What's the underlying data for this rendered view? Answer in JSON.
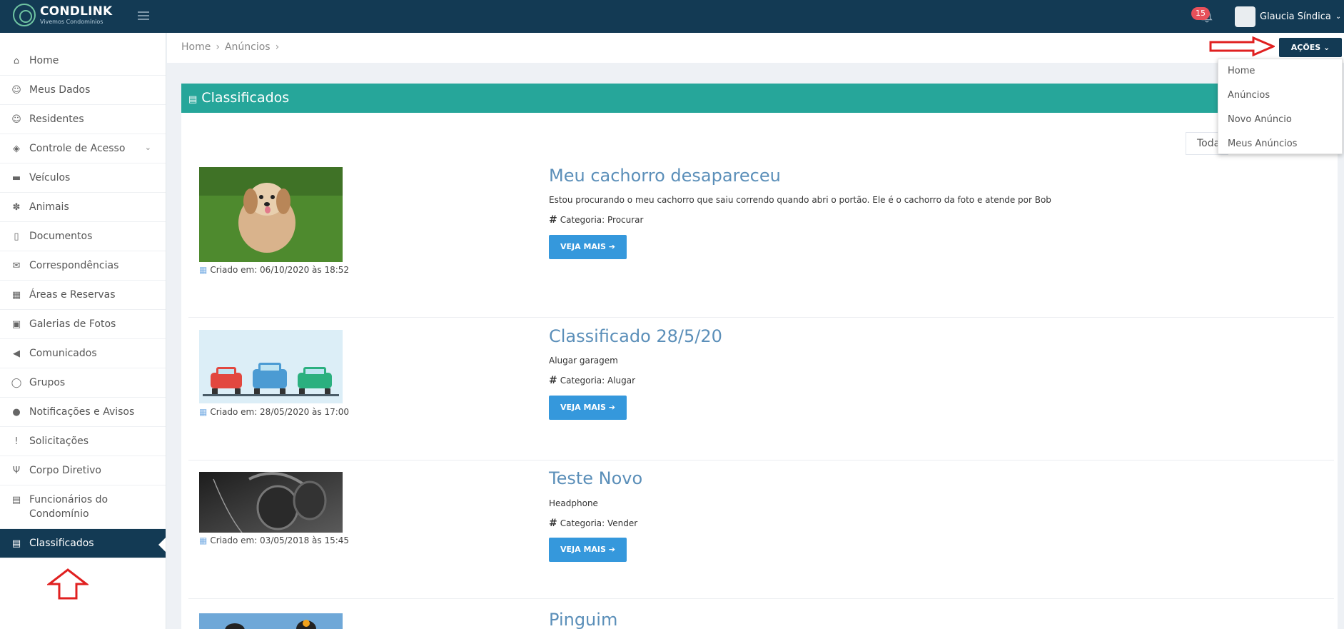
{
  "brand": {
    "name": "CONDLINK",
    "tagline": "Vivemos Condomínios"
  },
  "header": {
    "notifications_count": "15",
    "user_name": "Glaucia Síndica"
  },
  "sidebar": {
    "items": [
      {
        "label": "Home",
        "icon": "home-icon"
      },
      {
        "label": "Meus Dados",
        "icon": "user-icon"
      },
      {
        "label": "Residentes",
        "icon": "user-icon"
      },
      {
        "label": "Controle de Acesso",
        "icon": "tag-icon"
      },
      {
        "label": "Veículos",
        "icon": "car-icon"
      },
      {
        "label": "Animais",
        "icon": "paw-icon"
      },
      {
        "label": "Documentos",
        "icon": "file-icon"
      },
      {
        "label": "Correspondências",
        "icon": "envelope-open-icon"
      },
      {
        "label": "Áreas e Reservas",
        "icon": "calendar-icon"
      },
      {
        "label": "Galerias de Fotos",
        "icon": "image-icon"
      },
      {
        "label": "Comunicados",
        "icon": "bullhorn-icon"
      },
      {
        "label": "Grupos",
        "icon": "comments-icon"
      },
      {
        "label": "Notificações e Avisos",
        "icon": "info-icon"
      },
      {
        "label": "Solicitações",
        "icon": "exclamation-icon"
      },
      {
        "label": "Corpo Diretivo",
        "icon": "tie-icon"
      },
      {
        "label": "Funcionários do Condomínio",
        "icon": "building-icon"
      },
      {
        "label": "Classificados",
        "icon": "newspaper-icon"
      }
    ]
  },
  "breadcrumb": {
    "home": "Home",
    "current": "Anúncios"
  },
  "actions": {
    "button_label": "AÇÕES",
    "menu": [
      "Home",
      "Anúncios",
      "Novo Anúncio",
      "Meus Anúncios"
    ]
  },
  "panel": {
    "title": "Classificados",
    "filter_value": "Toda"
  },
  "ads": [
    {
      "title": "Meu cachorro desapareceu",
      "description": "Estou procurando o meu cachorro que saiu correndo quando abri o portão. Ele é o cachorro da foto e atende por Bob",
      "category": "Categoria: Procurar",
      "button": "VEJA MAIS",
      "date": "Criado em: 06/10/2020 às 18:52"
    },
    {
      "title": "Classificado 28/5/20",
      "description": "Alugar garagem",
      "category": "Categoria: Alugar",
      "button": "VEJA MAIS",
      "date": "Criado em: 28/05/2020 às 17:00"
    },
    {
      "title": "Teste Novo",
      "description": "Headphone",
      "category": "Categoria: Vender",
      "button": "VEJA MAIS",
      "date": "Criado em: 03/05/2018 às 15:45"
    },
    {
      "title": "Pinguim"
    }
  ],
  "colors": {
    "navy": "#133a54",
    "teal": "#26a69a",
    "button_blue": "#3598dc",
    "annotation_red": "#e02020"
  }
}
